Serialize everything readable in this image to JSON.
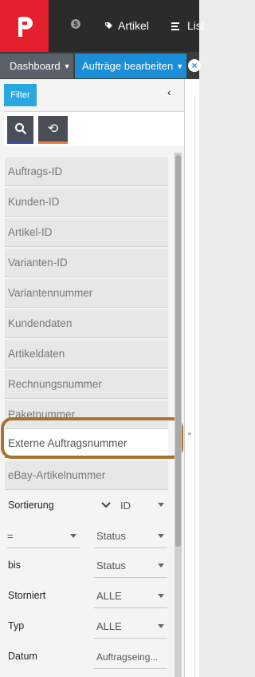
{
  "topnav": {
    "coin_symbol": "$",
    "artikel": "Artikel",
    "listen": "List"
  },
  "tabs": {
    "dashboard": "Dashboard",
    "active": "Aufträge bearbeiten",
    "close_symbol": "×"
  },
  "filter": {
    "label": "Filter",
    "collapse_symbol": "‹",
    "reset_symbol": "⟲",
    "fields": [
      "Auftrags-ID",
      "Kunden-ID",
      "Artikel-ID",
      "Varianten-ID",
      "Variantennummer",
      "Kundendaten",
      "Artikeldaten",
      "Rechnungsnummer",
      "Paketnummer",
      "Externe Auftragsnummer",
      "eBay-Artikelnummer"
    ],
    "sortierung_label": "Sortierung",
    "sortierung_value": "ID",
    "compare_value": "=",
    "status_value_1": "Status",
    "bis_label": "bis",
    "status_value_2": "Status",
    "storniert_label": "Storniert",
    "storniert_value": "ALLE",
    "typ_label": "Typ",
    "typ_value": "ALLE",
    "datum_label": "Datum",
    "datum_value": "Auftragseing..."
  },
  "main": {
    "quote_mark": "\""
  },
  "colors": {
    "brand_red": "#e4202e",
    "accent_blue": "#1a8fd8",
    "filter_blue": "#29a9e0",
    "highlight_brown": "#a8732e",
    "reset_orange": "#f07a3c"
  }
}
